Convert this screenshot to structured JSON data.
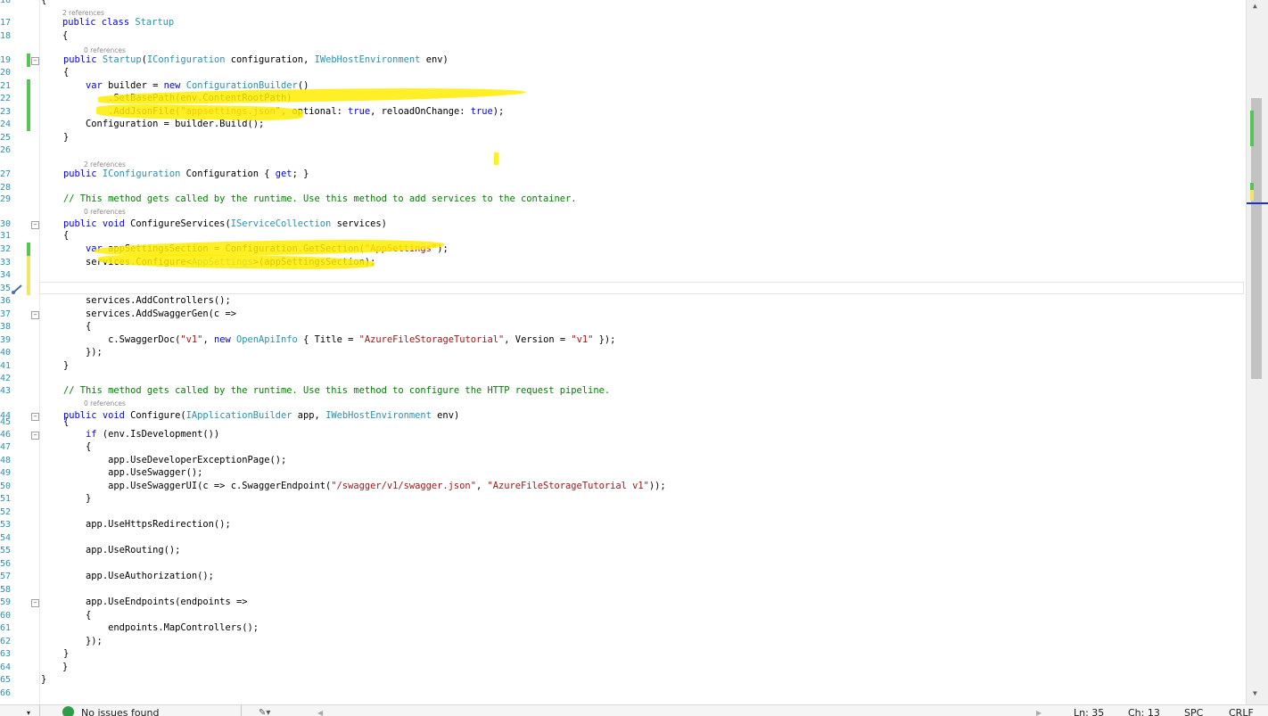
{
  "editor": {
    "lines": [
      {
        "n": "16",
        "refs": "",
        "tokens": [
          [
            "{",
            ""
          ]
        ]
      },
      {
        "n": "",
        "refs": "2 references",
        "tokens": []
      },
      {
        "n": "17",
        "refs": "",
        "tokens": [
          [
            "public class ",
            "kw"
          ],
          [
            "Startup",
            "ty"
          ]
        ]
      },
      {
        "n": "18",
        "refs": "",
        "tokens": [
          [
            "{",
            ""
          ]
        ]
      },
      {
        "n": "",
        "refs": "0 references",
        "tokens": []
      },
      {
        "n": "19",
        "refs": "",
        "tokens": [
          [
            "    public ",
            "kw"
          ],
          [
            "Startup",
            "ty"
          ],
          [
            "(",
            ""
          ],
          [
            "IConfiguration",
            "ty"
          ],
          [
            " configuration, ",
            ""
          ],
          [
            "IWebHostEnvironment",
            "ty"
          ],
          [
            " env)",
            ""
          ]
        ]
      },
      {
        "n": "20",
        "refs": "",
        "tokens": [
          [
            "    {",
            ""
          ]
        ]
      },
      {
        "n": "21",
        "refs": "",
        "tokens": [
          [
            "        ",
            ""
          ],
          [
            "var",
            "kw"
          ],
          [
            " builder = ",
            ""
          ],
          [
            "new ",
            "kw"
          ],
          [
            "ConfigurationBuilder",
            "ty"
          ],
          [
            "()",
            ""
          ]
        ]
      },
      {
        "n": "22",
        "refs": "",
        "tokens": [
          [
            "            .SetBasePath(env.ContentRootPath)",
            ""
          ]
        ]
      },
      {
        "n": "23",
        "refs": "",
        "tokens": [
          [
            "            .AddJsonFile(",
            ""
          ],
          [
            "\"appsettings.json\"",
            "st"
          ],
          [
            ", optional: ",
            ""
          ],
          [
            "true",
            "kw"
          ],
          [
            ", reloadOnChange: ",
            ""
          ],
          [
            "true",
            "kw"
          ],
          [
            ");",
            ""
          ]
        ]
      },
      {
        "n": "24",
        "refs": "",
        "tokens": [
          [
            "        Configuration = builder.Build();",
            ""
          ]
        ]
      },
      {
        "n": "25",
        "refs": "",
        "tokens": [
          [
            "    }",
            ""
          ]
        ]
      },
      {
        "n": "26",
        "refs": "",
        "tokens": []
      },
      {
        "n": "",
        "refs": "2 references",
        "tokens": []
      },
      {
        "n": "27",
        "refs": "",
        "tokens": [
          [
            "    public ",
            "kw"
          ],
          [
            "IConfiguration",
            "ty"
          ],
          [
            " Configuration { ",
            ""
          ],
          [
            "get",
            "kw"
          ],
          [
            "; }",
            ""
          ]
        ]
      },
      {
        "n": "28",
        "refs": "",
        "tokens": []
      },
      {
        "n": "29",
        "refs": "",
        "tokens": [
          [
            "    // This method gets called by the runtime. Use this method to add services to the container.",
            "cm"
          ]
        ]
      },
      {
        "n": "",
        "refs": "0 references",
        "tokens": []
      },
      {
        "n": "30",
        "refs": "",
        "tokens": [
          [
            "    public void ",
            "kw"
          ],
          [
            "ConfigureServices(",
            ""
          ],
          [
            "IServiceCollection",
            "ty"
          ],
          [
            " services)",
            ""
          ]
        ]
      },
      {
        "n": "31",
        "refs": "",
        "tokens": [
          [
            "    {",
            ""
          ]
        ]
      },
      {
        "n": "32",
        "refs": "",
        "tokens": [
          [
            "        ",
            ""
          ],
          [
            "var",
            "kw"
          ],
          [
            " appSettingsSection = Configuration.GetSection(",
            ""
          ],
          [
            "\"AppSettings\"",
            "st"
          ],
          [
            ");",
            ""
          ]
        ]
      },
      {
        "n": "33",
        "refs": "",
        "tokens": [
          [
            "        services.Configure<",
            ""
          ],
          [
            "AppSettings",
            "ty"
          ],
          [
            ">(appSettingsSection);",
            ""
          ]
        ]
      },
      {
        "n": "34",
        "refs": "",
        "tokens": []
      },
      {
        "n": "35",
        "refs": "",
        "tokens": []
      },
      {
        "n": "36",
        "refs": "",
        "tokens": [
          [
            "        services.AddControllers();",
            ""
          ]
        ]
      },
      {
        "n": "37",
        "refs": "",
        "tokens": [
          [
            "        services.AddSwaggerGen(c =>",
            ""
          ]
        ]
      },
      {
        "n": "38",
        "refs": "",
        "tokens": [
          [
            "        {",
            ""
          ]
        ]
      },
      {
        "n": "39",
        "refs": "",
        "tokens": [
          [
            "            c.SwaggerDoc(",
            ""
          ],
          [
            "\"v1\"",
            "st"
          ],
          [
            ", ",
            ""
          ],
          [
            "new ",
            "kw"
          ],
          [
            "OpenApiInfo",
            "ty"
          ],
          [
            " { Title = ",
            ""
          ],
          [
            "\"AzureFileStorageTutorial\"",
            "st"
          ],
          [
            ", Version = ",
            ""
          ],
          [
            "\"v1\"",
            "st"
          ],
          [
            " });",
            ""
          ]
        ]
      },
      {
        "n": "40",
        "refs": "",
        "tokens": [
          [
            "        });",
            ""
          ]
        ]
      },
      {
        "n": "41",
        "refs": "",
        "tokens": [
          [
            "    }",
            ""
          ]
        ]
      },
      {
        "n": "42",
        "refs": "",
        "tokens": []
      },
      {
        "n": "43",
        "refs": "",
        "tokens": [
          [
            "    // This method gets called by the runtime. Use this method to configure the HTTP request pipeline.",
            "cm"
          ]
        ]
      },
      {
        "n": "",
        "refs": "0 references",
        "tokens": []
      },
      {
        "n": "44",
        "refs": "",
        "tokens": [
          [
            "    public void ",
            "kw"
          ],
          [
            "Configure(",
            ""
          ],
          [
            "IApplicationBuilder",
            "ty"
          ],
          [
            " app, ",
            ""
          ],
          [
            "IWebHostEnvironment",
            "ty"
          ],
          [
            " env)",
            ""
          ]
        ]
      },
      {
        "n": "45",
        "refs": "",
        "tokens": [
          [
            "    {",
            ""
          ]
        ]
      },
      {
        "n": "46",
        "refs": "",
        "tokens": [
          [
            "        ",
            ""
          ],
          [
            "if",
            "kw"
          ],
          [
            " (env.IsDevelopment())",
            ""
          ]
        ]
      },
      {
        "n": "47",
        "refs": "",
        "tokens": [
          [
            "        {",
            ""
          ]
        ]
      },
      {
        "n": "48",
        "refs": "",
        "tokens": [
          [
            "            app.UseDeveloperExceptionPage();",
            ""
          ]
        ]
      },
      {
        "n": "49",
        "refs": "",
        "tokens": [
          [
            "            app.UseSwagger();",
            ""
          ]
        ]
      },
      {
        "n": "50",
        "refs": "",
        "tokens": [
          [
            "            app.UseSwaggerUI(c => c.SwaggerEndpoint(",
            ""
          ],
          [
            "\"/swagger/v1/swagger.json\"",
            "st"
          ],
          [
            ", ",
            ""
          ],
          [
            "\"AzureFileStorageTutorial v1\"",
            "st"
          ],
          [
            "));",
            ""
          ]
        ]
      },
      {
        "n": "51",
        "refs": "",
        "tokens": [
          [
            "        }",
            ""
          ]
        ]
      },
      {
        "n": "52",
        "refs": "",
        "tokens": []
      },
      {
        "n": "53",
        "refs": "",
        "tokens": [
          [
            "        app.UseHttpsRedirection();",
            ""
          ]
        ]
      },
      {
        "n": "54",
        "refs": "",
        "tokens": []
      },
      {
        "n": "55",
        "refs": "",
        "tokens": [
          [
            "        app.UseRouting();",
            ""
          ]
        ]
      },
      {
        "n": "56",
        "refs": "",
        "tokens": []
      },
      {
        "n": "57",
        "refs": "",
        "tokens": [
          [
            "        app.UseAuthorization();",
            ""
          ]
        ]
      },
      {
        "n": "58",
        "refs": "",
        "tokens": []
      },
      {
        "n": "59",
        "refs": "",
        "tokens": [
          [
            "        app.UseEndpoints(endpoints =>",
            ""
          ]
        ]
      },
      {
        "n": "60",
        "refs": "",
        "tokens": [
          [
            "        {",
            ""
          ]
        ]
      },
      {
        "n": "61",
        "refs": "",
        "tokens": [
          [
            "            endpoints.MapControllers();",
            ""
          ]
        ]
      },
      {
        "n": "62",
        "refs": "",
        "tokens": [
          [
            "        });",
            ""
          ]
        ]
      },
      {
        "n": "63",
        "refs": "",
        "tokens": [
          [
            "    }",
            ""
          ]
        ]
      },
      {
        "n": "64",
        "refs": "",
        "tokens": [
          [
            "}",
            ""
          ]
        ]
      },
      {
        "n": "65",
        "refs": "",
        "tokens": [
          [
            "}",
            ""
          ]
        ]
      },
      {
        "n": "66",
        "refs": "",
        "tokens": []
      }
    ]
  },
  "status_bar": {
    "issues": "No issues found",
    "line": "Ln: 35",
    "char": "Ch: 13",
    "mode": "SPC",
    "eol": "CRLF"
  },
  "colors": {
    "keyword": "#0000ff",
    "type": "#2b91af",
    "string": "#a31515",
    "comment": "#008000",
    "highlight": "#ffec00"
  }
}
